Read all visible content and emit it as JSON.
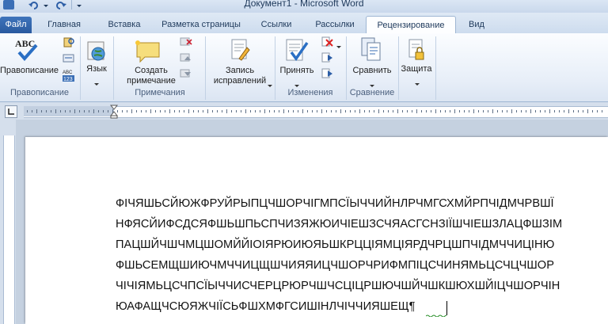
{
  "window": {
    "title": "Документ1 - Microsoft Word"
  },
  "tabs": [
    {
      "label": "Файл",
      "active": false
    },
    {
      "label": "Главная",
      "active": false
    },
    {
      "label": "Вставка",
      "active": false
    },
    {
      "label": "Разметка страницы",
      "active": false
    },
    {
      "label": "Ссылки",
      "active": false
    },
    {
      "label": "Рассылки",
      "active": false
    },
    {
      "label": "Рецензирование",
      "active": true
    },
    {
      "label": "Вид",
      "active": false
    }
  ],
  "ribbon": {
    "spelling": {
      "label": "Правописание",
      "icon": "abc-spellcheck-icon"
    },
    "language": {
      "label": "Язык",
      "icon": "globe-icon"
    },
    "new_comment": {
      "label_line1": "Создать",
      "label_line2": "примечание",
      "icon": "sticky-note-icon"
    },
    "track_changes": {
      "label_line1": "Запись",
      "label_line2": "исправлений",
      "icon": "document-pen-icon"
    },
    "accept": {
      "label": "Принять",
      "icon": "document-check-icon"
    },
    "compare": {
      "label": "Сравнить",
      "icon": "compare-docs-icon"
    },
    "protect": {
      "label": "Защита",
      "icon": "lock-document-icon"
    },
    "groups": {
      "spelling": "Правописание",
      "comments": "Примечания",
      "changes": "Изменения",
      "compare": "Сравнение"
    }
  },
  "document": {
    "lines": [
      "ФІЧЯШЬСЙЮЖФРУЙРЫПЦЧШОРЧІГМПСЇЫЧЧИЙНЛРЧМГСХМЙРПЧІДМЧРВШЇ",
      "НФЯСЙИФСДСЯФШЬШПЬСПЧИЗЯЖЮИЧІЕШЗСЧЯАСГСНЗІЇШЧІЕШЗЛАЦФШЗІМ",
      "ПАЦШЙЧШЧМЦШОМЙЙІОІЯРЮИЮЯЬШКРЦЦІЯМЦІЯРДЧРЦШПЧІДМЧЧИЦІНЮ",
      "ФШЬСЕМЩШИЮЧМЧЧИЦЩШЧИЯЯИЦЧШОРЧРИФМПІЦСЧИНЯМЬЦСЧЦЧШОР",
      "ЧІЧІЯМЬЦСЧПСЇЫЧЧИСЧЕРЦРЮРЧШЧСЦІЦРШЮЧШЙЧШКШЮХШЙІЦЧШОРЧІН",
      "ЮАФАЩЧСЮЯЖЧІЇСЬФШХМФГСИШІНЛЧІЧЧИЯШЕЩ"
    ],
    "pilcrow": "¶"
  },
  "colors": {
    "file_tab": "#2b579a",
    "ribbon_text": "#1e395b"
  }
}
